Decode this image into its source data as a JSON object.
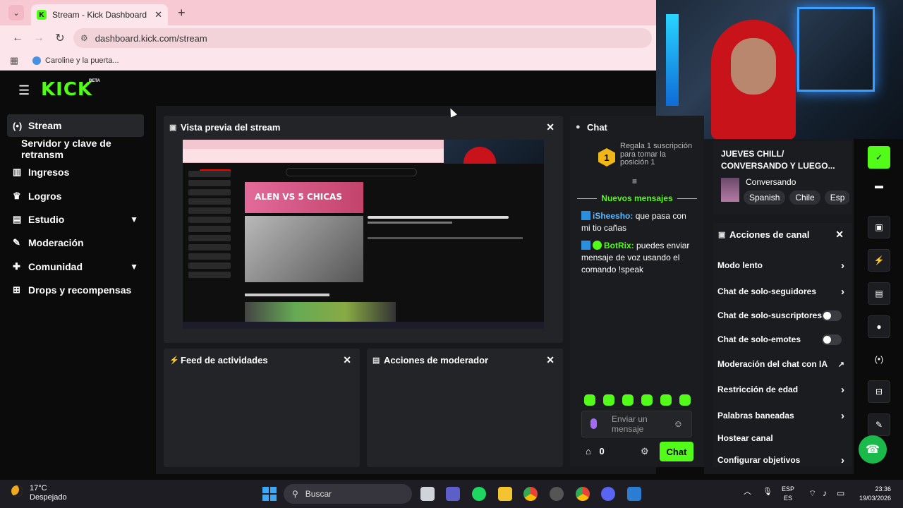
{
  "browser": {
    "tab_title": "Stream - Kick Dashboard",
    "url": "dashboard.kick.com/stream",
    "bookmark": "Caroline y la puerta..."
  },
  "kick": {
    "logo": "KICK",
    "beta": "BETA"
  },
  "sidebar": {
    "items": [
      {
        "label": "Stream"
      },
      {
        "label": "Servidor y clave de retransm"
      },
      {
        "label": "Ingresos"
      },
      {
        "label": "Logros"
      },
      {
        "label": "Estudio"
      },
      {
        "label": "Moderación"
      },
      {
        "label": "Comunidad"
      },
      {
        "label": "Drops y recompensas"
      }
    ]
  },
  "panels": {
    "preview": "Vista previa del stream",
    "feed": "Feed de actividades",
    "mod_actions": "Acciones de moderador",
    "chat": "Chat",
    "channel_actions": "Acciones de canal"
  },
  "preview_content": {
    "thumb_text": "ALEN VS 5 CHICAS"
  },
  "chat": {
    "gift_rank": "1",
    "gift_text": "Regala 1 suscripción para tomar la posición 1",
    "new_messages": "Nuevos mensajes",
    "messages": [
      {
        "user": "iSheesho:",
        "text": "que pasa con mi tio cañas"
      },
      {
        "user": "BotRix:",
        "text": "puedes enviar mensaje de voz usando el comando !speak"
      }
    ],
    "input_placeholder": "Enviar un mensaje",
    "points": "0",
    "send_label": "Chat"
  },
  "stream_info": {
    "title": "JUEVES CHILL/ CONVERSANDO Y LUEGO...",
    "category": "Conversando",
    "tags": [
      "Spanish",
      "Chile",
      "Esp"
    ]
  },
  "channel_actions": [
    {
      "label": "Modo lento",
      "control": "chevron"
    },
    {
      "label": "Chat de solo-seguidores",
      "control": "chevron"
    },
    {
      "label": "Chat de solo-suscriptores",
      "control": "toggle"
    },
    {
      "label": "Chat de solo-emotes",
      "control": "toggle"
    },
    {
      "label": "Moderación del chat con IA",
      "control": "external"
    },
    {
      "label": "Restricción de edad",
      "control": "chevron"
    },
    {
      "label": "Palabras baneadas",
      "control": "chevron"
    },
    {
      "label": "Hostear canal",
      "control": "none"
    },
    {
      "label": "Configurar objetivos",
      "control": "chevron"
    }
  ],
  "taskbar": {
    "temp": "17°C",
    "weather": "Despejado",
    "search": "Buscar",
    "lang1": "ESP",
    "lang2": "ES",
    "time": "23:36",
    "date": "19/03/2026"
  },
  "colors": {
    "kick_green": "#53fc18",
    "browser_pink": "#fde6eb"
  }
}
